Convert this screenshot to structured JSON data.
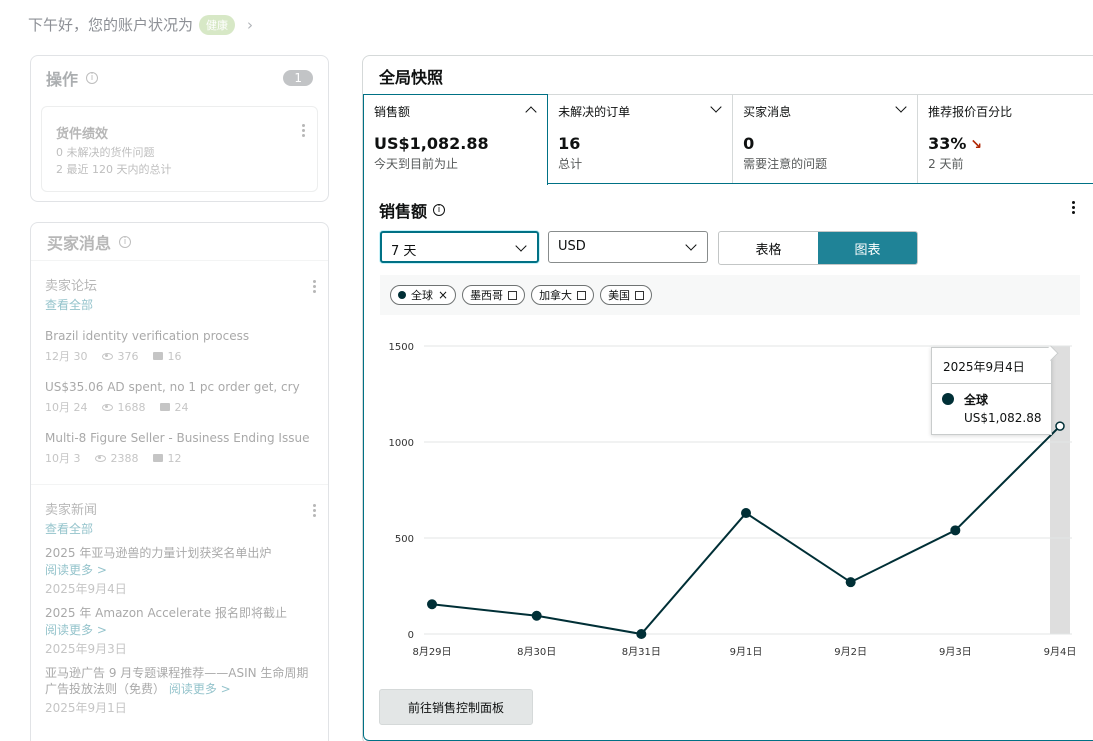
{
  "greeting": {
    "text": "下午好，您的账户状况为",
    "badge": "健康"
  },
  "operations": {
    "title": "操作",
    "count": "1",
    "card": {
      "title": "货件绩效",
      "line1": "0  未解决的货件问题",
      "line2": "2  最近 120 天内的总计"
    }
  },
  "buyer_messages": {
    "title": "买家消息",
    "forum": {
      "title": "卖家论坛",
      "link": "查看全部",
      "posts": [
        {
          "title": "Brazil identity verification process",
          "date": "12月 30",
          "views": "376",
          "replies": "16"
        },
        {
          "title": "US$35.06 AD spent, no 1 pc order get, cry",
          "date": "10月 24",
          "views": "1688",
          "replies": "24"
        },
        {
          "title": "Multi-8 Figure Seller - Business Ending Issue 8",
          "date": "10月 3",
          "views": "2388",
          "replies": "12"
        }
      ]
    },
    "news": {
      "title": "卖家新闻",
      "link": "查看全部",
      "items": [
        {
          "title": "2025 年亚马逊兽的力量计划获奖名单出炉",
          "link": "阅读更多 >",
          "date": "2025年9月4日"
        },
        {
          "title": "2025 年 Amazon Accelerate 报名即将截止",
          "link": "阅读更多 >",
          "date": "2025年9月3日"
        },
        {
          "title": "亚马逊广告 9 月专题课程推荐——ASIN 生命周期广告投放法则（免费）",
          "link": "阅读更多 >",
          "date": "2025年9月1日"
        }
      ]
    }
  },
  "snapshot": {
    "title": "全局快照",
    "metrics": [
      {
        "label": "销售额",
        "value": "US$1,082.88",
        "sub": "今天到目前为止"
      },
      {
        "label": "未解决的订单",
        "value": "16",
        "sub": "总计"
      },
      {
        "label": "买家消息",
        "value": "0",
        "sub": "需要注意的问题"
      },
      {
        "label": "推荐报价百分比",
        "value": "33%",
        "sub": "2 天前"
      }
    ]
  },
  "sales_panel": {
    "title": "销售额",
    "range_select": "7 天",
    "currency_select": "USD",
    "view_toggle": {
      "table": "表格",
      "chart": "图表"
    },
    "filters": [
      "全球",
      "墨西哥",
      "加拿大",
      "美国"
    ],
    "tooltip": {
      "date": "2025年9月4日",
      "series": "全球",
      "value": "US$1,082.88"
    },
    "cta": "前往销售控制面板"
  },
  "colors": {
    "accent": "#007185",
    "toggle_on": "#1f8397",
    "series": "#002f36",
    "trend_down": "#b12704"
  },
  "chart_data": {
    "type": "line",
    "x": [
      "8月29日",
      "8月30日",
      "8月31日",
      "9月1日",
      "9月2日",
      "9月3日",
      "9月4日"
    ],
    "series": [
      {
        "name": "全球",
        "values": [
          155,
          95,
          0,
          630,
          270,
          540,
          1082.88
        ]
      }
    ],
    "yticks": [
      "0",
      "500",
      "1000",
      "1500"
    ],
    "ylim": [
      0,
      1500
    ],
    "grid": true,
    "highlighted_index": 6
  }
}
